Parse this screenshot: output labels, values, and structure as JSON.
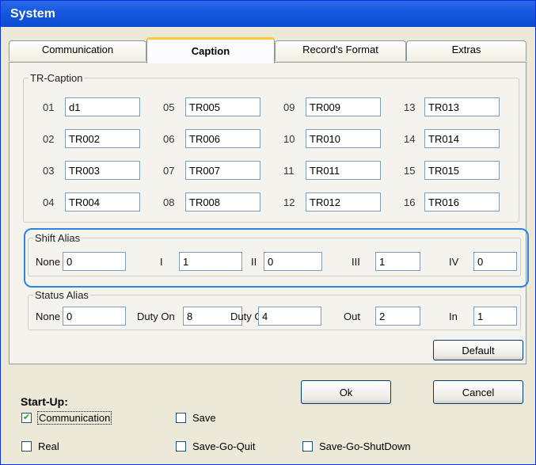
{
  "window": {
    "title": "System"
  },
  "tabs": [
    {
      "label": "Communication"
    },
    {
      "label": "Caption"
    },
    {
      "label": "Record's Format"
    },
    {
      "label": "Extras"
    }
  ],
  "tr_caption": {
    "legend": "TR-Caption",
    "items": [
      {
        "num": "01",
        "value": "d1"
      },
      {
        "num": "02",
        "value": "TR002"
      },
      {
        "num": "03",
        "value": "TR003"
      },
      {
        "num": "04",
        "value": "TR004"
      },
      {
        "num": "05",
        "value": "TR005"
      },
      {
        "num": "06",
        "value": "TR006"
      },
      {
        "num": "07",
        "value": "TR007"
      },
      {
        "num": "08",
        "value": "TR008"
      },
      {
        "num": "09",
        "value": "TR009"
      },
      {
        "num": "10",
        "value": "TR010"
      },
      {
        "num": "11",
        "value": "TR011"
      },
      {
        "num": "12",
        "value": "TR012"
      },
      {
        "num": "13",
        "value": "TR013"
      },
      {
        "num": "14",
        "value": "TR014"
      },
      {
        "num": "15",
        "value": "TR015"
      },
      {
        "num": "16",
        "value": "TR016"
      }
    ]
  },
  "shift_alias": {
    "legend": "Shift Alias",
    "items": [
      {
        "label": "None",
        "value": "0"
      },
      {
        "label": "I",
        "value": "1"
      },
      {
        "label": "II",
        "value": "0"
      },
      {
        "label": "III",
        "value": "1"
      },
      {
        "label": "IV",
        "value": "0"
      }
    ]
  },
  "status_alias": {
    "legend": "Status Alias",
    "items": [
      {
        "label": "None",
        "value": "0"
      },
      {
        "label": "Duty On",
        "value": "8"
      },
      {
        "label": "Duty Off",
        "value": "4"
      },
      {
        "label": "Out",
        "value": "2"
      },
      {
        "label": "In",
        "value": "1"
      }
    ]
  },
  "buttons": {
    "default": "Default",
    "ok": "Ok",
    "cancel": "Cancel"
  },
  "startup": {
    "title": "Start-Up:",
    "options": [
      {
        "label": "Communication",
        "checked": true
      },
      {
        "label": "Save",
        "checked": false
      },
      {
        "label": "Real",
        "checked": false
      },
      {
        "label": "Save-Go-Quit",
        "checked": false
      },
      {
        "label": "Save-Go-ShutDown",
        "checked": false
      }
    ]
  },
  "colors": {
    "title_bar": "#0a4ccd",
    "highlight_outline": "#2b86e0",
    "tab_accent": "#ffc83c"
  }
}
